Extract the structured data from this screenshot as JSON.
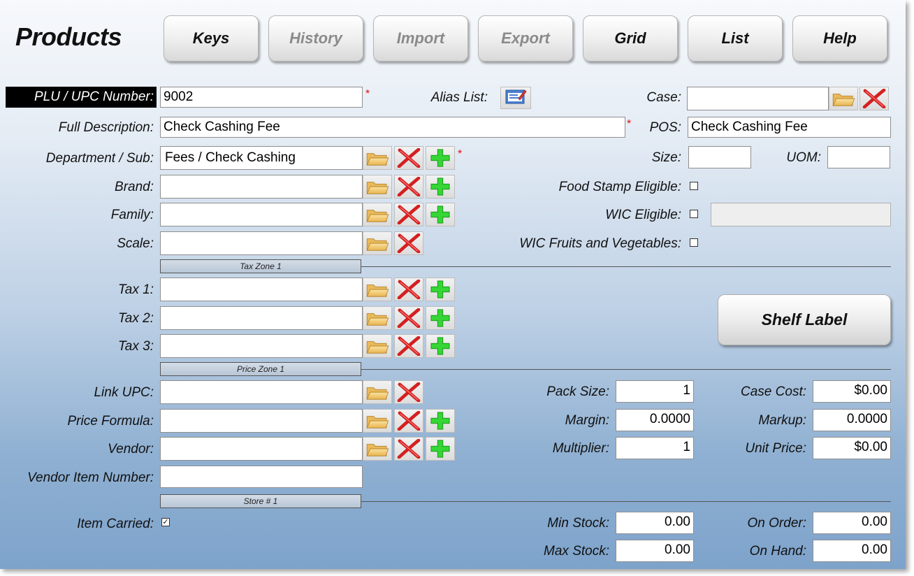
{
  "title": "Products",
  "toolbar": {
    "keys": "Keys",
    "history": "History",
    "import": "Import",
    "export": "Export",
    "grid": "Grid",
    "list": "List",
    "help": "Help"
  },
  "required_mark": "*",
  "labels": {
    "plu": "PLU / UPC Number:",
    "full_description": "Full Description:",
    "department": "Department / Sub:",
    "brand": "Brand:",
    "family": "Family:",
    "scale": "Scale:",
    "tax1": "Tax 1:",
    "tax2": "Tax 2:",
    "tax3": "Tax 3:",
    "link_upc": "Link UPC:",
    "price_formula": "Price Formula:",
    "vendor": "Vendor:",
    "vendor_item_number": "Vendor Item Number:",
    "item_carried": "Item Carried:",
    "alias_list": "Alias List:",
    "case": "Case:",
    "pos": "POS:",
    "size": "Size:",
    "uom": "UOM:",
    "food_stamp": "Food Stamp Eligible:",
    "wic": "WIC Eligible:",
    "wic_fruits": "WIC Fruits and Vegetables:",
    "pack_size": "Pack Size:",
    "margin": "Margin:",
    "multiplier": "Multiplier:",
    "case_cost": "Case Cost:",
    "markup": "Markup:",
    "unit_price": "Unit Price:",
    "min_stock": "Min Stock:",
    "max_stock": "Max Stock:",
    "on_order": "On Order:",
    "on_hand": "On Hand:"
  },
  "values": {
    "plu": "9002",
    "full_description": "Check Cashing Fee",
    "department": "Fees / Check Cashing",
    "brand": "",
    "family": "",
    "scale": "",
    "tax1": "",
    "tax2": "",
    "tax3": "",
    "link_upc": "",
    "price_formula": "",
    "vendor": "",
    "vendor_item_number": "",
    "case": "",
    "pos": "Check Cashing Fee",
    "size": "",
    "uom": "",
    "wic_extra": "",
    "pack_size": "1",
    "margin": "0.0000",
    "multiplier": "1",
    "case_cost": "$0.00",
    "markup": "0.0000",
    "unit_price": "$0.00",
    "min_stock": "0.00",
    "max_stock": "0.00",
    "on_order": "0.00",
    "on_hand": "0.00"
  },
  "checkboxes": {
    "food_stamp": false,
    "wic": false,
    "wic_fruits": false,
    "item_carried": true
  },
  "zones": {
    "tax_zone": "Tax Zone 1",
    "price_zone": "Price Zone 1",
    "store": "Store # 1"
  },
  "shelf_label": "Shelf Label",
  "icons": {
    "browse": "folder-icon",
    "clear": "red-x-icon",
    "add": "green-plus-icon",
    "alias": "edit-list-icon"
  },
  "colors": {
    "plu_label_bg": "#000000",
    "plu_label_text": "#ffffff",
    "required": "#e01010",
    "add_green": "#2ecc2e",
    "clear_red": "#d92020",
    "folder_yellow": "#f2c453"
  }
}
